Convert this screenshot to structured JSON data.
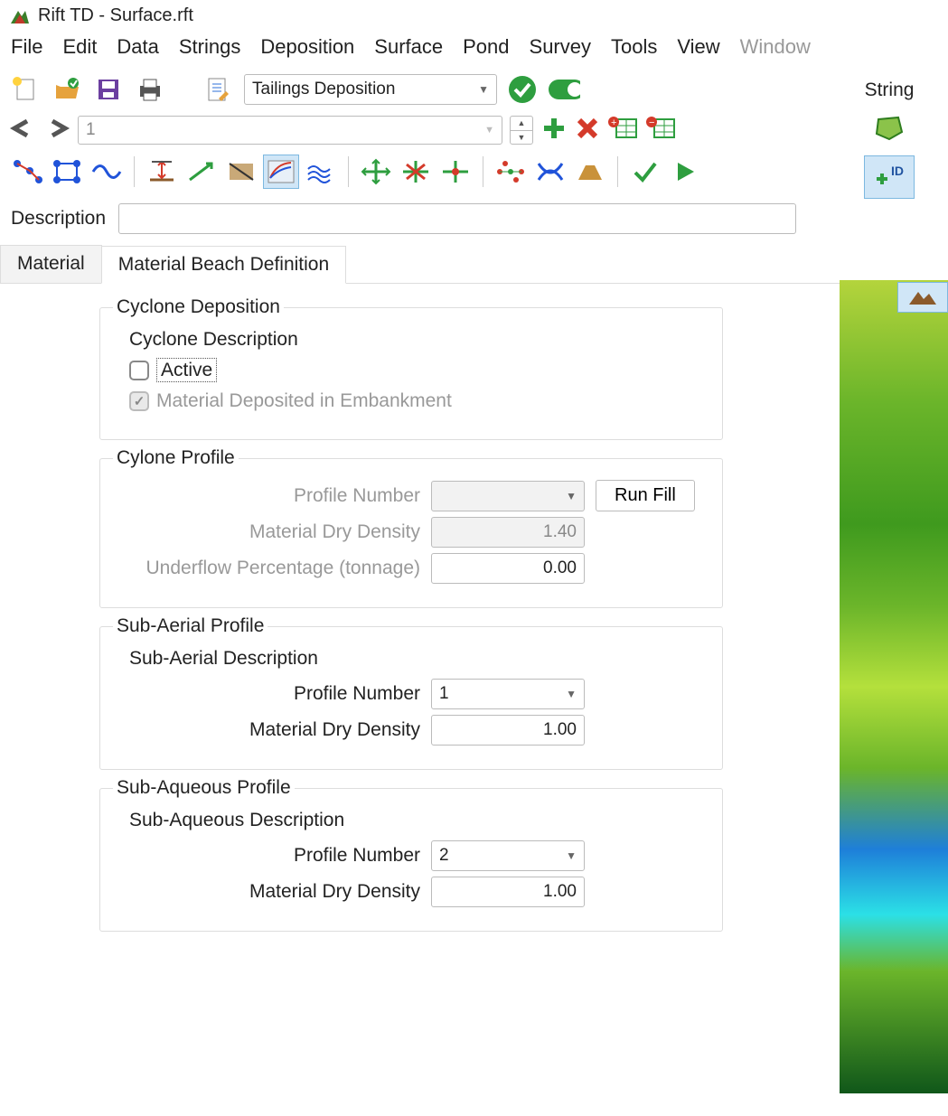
{
  "title": "Rift TD - Surface.rft",
  "menu": [
    "File",
    "Edit",
    "Data",
    "Strings",
    "Deposition",
    "Surface",
    "Pond",
    "Survey",
    "Tools",
    "View",
    "Window"
  ],
  "menu_disabled": [
    "Window"
  ],
  "layer_select": "Tailings Deposition",
  "right_label": "String",
  "nav_value": "1",
  "desc_label": "Description",
  "desc_value": "",
  "tabs": {
    "material": "Material",
    "beach": "Material Beach Definition"
  },
  "cyclone": {
    "legend": "Cyclone Deposition",
    "heading": "Cyclone Description",
    "active_label": "Active",
    "active_checked": false,
    "embank_label": "Material Deposited in Embankment",
    "embank_checked": true
  },
  "cyclone_profile": {
    "legend": "Cylone Profile",
    "profile_label": "Profile Number",
    "profile_value": "",
    "density_label": "Material Dry Density",
    "density_value": "1.40",
    "underflow_label": "Underflow Percentage (tonnage)",
    "underflow_value": "0.00",
    "runfill": "Run Fill"
  },
  "subaerial": {
    "legend": "Sub-Aerial Profile",
    "heading": "Sub-Aerial Description",
    "profile_label": "Profile Number",
    "profile_value": "1",
    "density_label": "Material Dry Density",
    "density_value": "1.00"
  },
  "subaq": {
    "legend": "Sub-Aqueous Profile",
    "heading": "Sub-Aqueous Description",
    "profile_label": "Profile Number",
    "profile_value": "2",
    "density_label": "Material Dry Density",
    "density_value": "1.00"
  }
}
